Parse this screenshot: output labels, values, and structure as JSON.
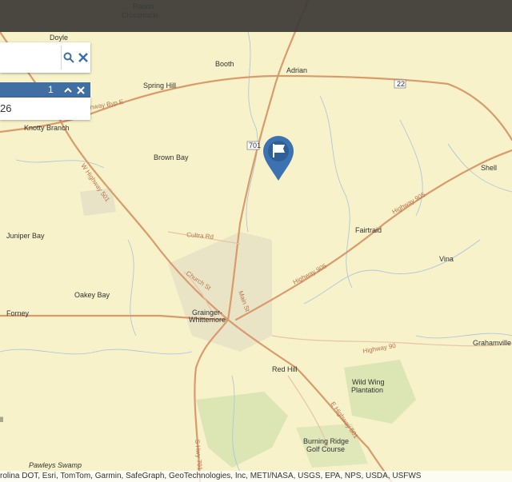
{
  "places": {
    "rabon": "Rabon\nCrossroads",
    "doyle": "Doyle",
    "booth": "Booth",
    "adrian": "Adrian",
    "spring_hill": "Spring Hill",
    "knotty_branch": "Knotty Branch",
    "brown_bay": "Brown Bay",
    "shell": "Shell",
    "fairtraid": "Fairtraid",
    "juniper_bay": "Juniper Bay",
    "vina": "Vina",
    "oakey_bay": "Oakey Bay",
    "forney": "Forney",
    "grainger_whittemore": "Grainger-\nWhittemore",
    "grahamville": "Grahamville",
    "red_hill": "Red Hill",
    "wild_wing": "Wild Wing\nPlantation",
    "burning_ridge": "Burning Ridge\nGolf Course",
    "pawleys_swamp": "Pawleys Swamp",
    "l_fragment": "ll"
  },
  "roads": {
    "byp": "nway Byp E",
    "w_hwy_501": "W Highway 501",
    "highway_905": "Highway 905",
    "cultra": "Cultra Rd",
    "church": "Church St",
    "main": "Main St",
    "highway_905b": "Highway 905",
    "highway_90": "Highway 90",
    "e_hwy_501": "E Highway 501",
    "s_701": "S Hwy 701",
    "shield_701": "701",
    "shield_22": "22"
  },
  "search": {
    "value": "",
    "placeholder": ""
  },
  "results": {
    "count": "1",
    "text": "26"
  },
  "attribution": "rolina DOT, Esri, TomTom, Garmin, SafeGraph, GeoTechnologies, Inc, METI/NASA, USGS, EPA, NPS, USDA, USFWS",
  "colors": {
    "map_bg": "#f7f2c9",
    "road": "#d99a6c",
    "pin": "#3d72b2",
    "result_bar": "#3f6fa3"
  }
}
